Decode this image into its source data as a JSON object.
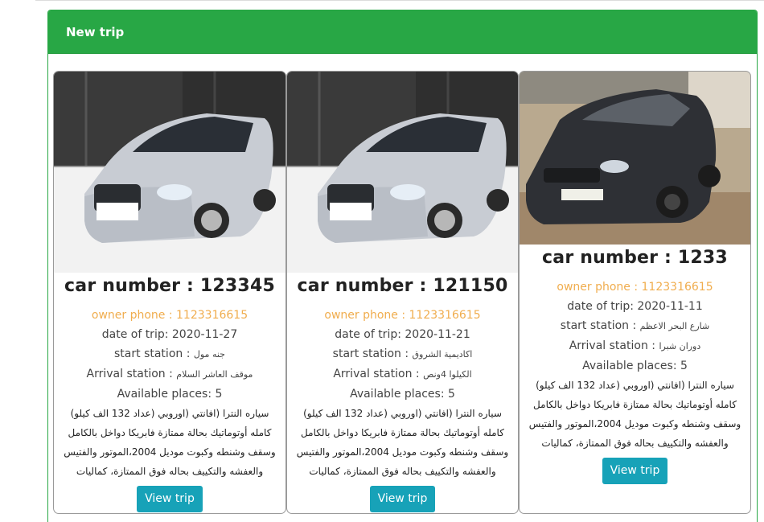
{
  "panel": {
    "title": "New trip"
  },
  "trips": [
    {
      "car_label": "car number : 123345",
      "owner_phone": "owner phone : 1123316615",
      "date_of_trip": "date of trip: 2020-11-27",
      "start_label": "start station :",
      "start_value": "جنه مول",
      "arrival_label": "Arrival station :",
      "arrival_value": "موقف العاشر السلام",
      "available": "Available places: 5",
      "description": "سياره النترا (افانتي (اوروبي (عداد 132 الف كيلو) كامله أوتوماتيك بحالة ممتازة فابريكا دواخل بالكامل وسقف وشنطه وكبوت موديل 2004،الموتور والفتيس والعفشه والتكييف بحاله فوق الممتازة، كماليات",
      "view_label": "View trip",
      "car_color": "silver"
    },
    {
      "car_label": "car number : 121150",
      "owner_phone": "owner phone : 1123316615",
      "date_of_trip": "date of trip: 2020-11-21",
      "start_label": "start station :",
      "start_value": "اكاديمية الشروق",
      "arrival_label": "Arrival station :",
      "arrival_value": "الكيلوا 4ونص",
      "available": "Available places: 5",
      "description": "سياره النترا (افانتي (اوروبي (عداد 132 الف كيلو) كامله أوتوماتيك بحالة ممتازة فابريكا دواخل بالكامل وسقف وشنطه وكبوت موديل 2004،الموتور والفتيس والعفشه والتكييف بحاله فوق الممتازة، كماليات",
      "view_label": "View trip",
      "car_color": "silver"
    },
    {
      "car_label": "car number : 1233",
      "owner_phone": "owner phone : 1123316615",
      "date_of_trip": "date of trip: 2020-11-11",
      "start_label": "start station :",
      "start_value": "شارع البحر الاعظم",
      "arrival_label": "Arrival station :",
      "arrival_value": "دوران شبرا",
      "available": "Available places: 5",
      "description": "سياره النترا (افانتي (اوروبي (عداد 132 الف كيلو) كامله أوتوماتيك بحالة ممتازة فابريكا دواخل بالكامل وسقف وشنطه وكبوت موديل 2004،الموتور والفتيس والعفشه والتكييف بحاله فوق الممتازة، كماليات",
      "view_label": "View trip",
      "car_color": "dark"
    }
  ]
}
